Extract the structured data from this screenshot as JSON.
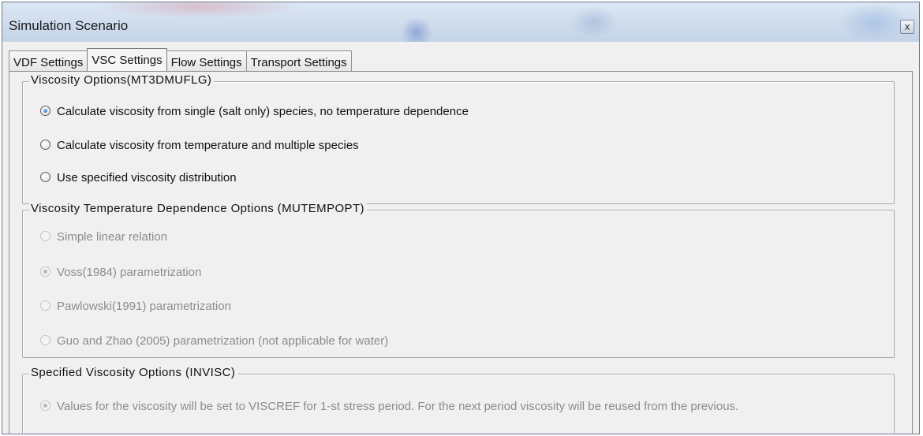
{
  "window": {
    "title": "Simulation Scenario",
    "close_glyph": "x"
  },
  "tabs": [
    {
      "label": "VDF Settings",
      "active": false
    },
    {
      "label": "VSC Settings",
      "active": true
    },
    {
      "label": "Flow Settings",
      "active": false
    },
    {
      "label": "Transport Settings",
      "active": false
    }
  ],
  "viscosity_options": {
    "title": "Viscosity Options(MT3DMUFLG)",
    "options": [
      {
        "label": "Calculate viscosity from single (salt only) species, no temperature dependence",
        "selected": true,
        "enabled": true
      },
      {
        "label": "Calculate viscosity from temperature and multiple species",
        "selected": false,
        "enabled": true
      },
      {
        "label": "Use specified viscosity distribution",
        "selected": false,
        "enabled": true
      }
    ]
  },
  "temperature_options": {
    "title": "Viscosity Temperature Dependence Options (MUTEMPOPT)",
    "options": [
      {
        "label": "Simple linear relation",
        "selected": false,
        "enabled": false
      },
      {
        "label": "Voss(1984) parametrization",
        "selected": true,
        "enabled": false
      },
      {
        "label": "Pawlowski(1991) parametrization",
        "selected": false,
        "enabled": false
      },
      {
        "label": "Guo and Zhao (2005) parametrization (not applicable for water)",
        "selected": false,
        "enabled": false
      }
    ]
  },
  "specified_options": {
    "title": "Specified Viscosity Options (INVISC)",
    "options": [
      {
        "label": "Values for the viscosity will be set to VISCREF for 1-st stress period. For the next period viscosity will be reused from the previous.",
        "selected": true,
        "enabled": false
      }
    ]
  },
  "colors": {
    "title_bar": "#cfdcec",
    "dialog_bg": "#f0f0f0",
    "disabled_text": "#8c8c8c",
    "radio_checked": "#1f5ea8"
  }
}
